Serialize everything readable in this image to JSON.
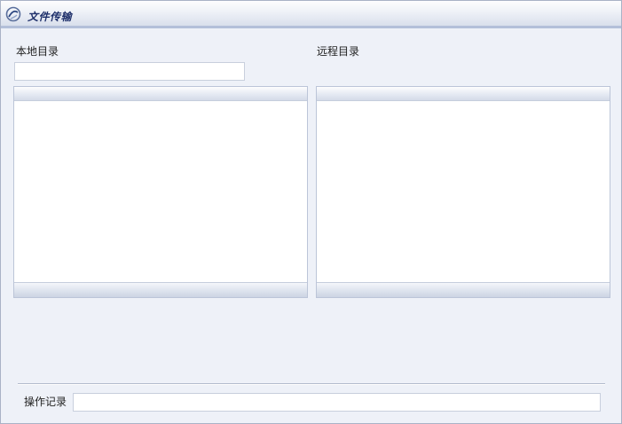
{
  "window": {
    "title": "文件传输",
    "icon": "app-swirl-icon"
  },
  "local": {
    "label": "本地目录",
    "path_value": ""
  },
  "remote": {
    "label": "远程目录"
  },
  "log": {
    "label": "操作记录",
    "value": ""
  },
  "colors": {
    "title_text": "#1d2f6a",
    "background": "#eef1f8",
    "border": "#bcc5d8"
  }
}
